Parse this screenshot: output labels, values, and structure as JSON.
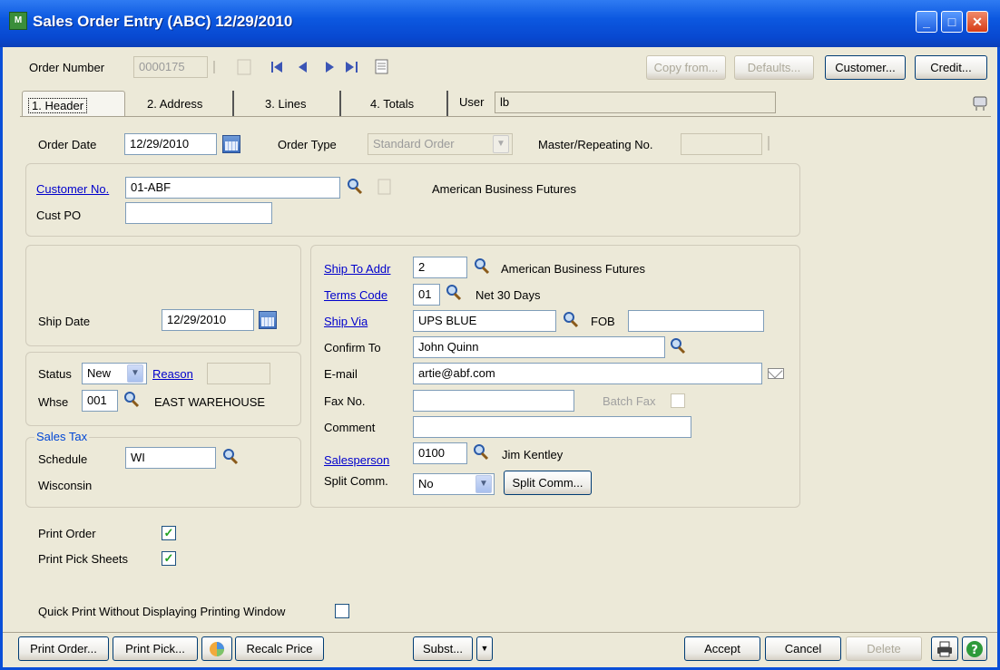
{
  "window": {
    "title": "Sales Order Entry (ABC) 12/29/2010"
  },
  "toolbar": {
    "order_number_label": "Order Number",
    "order_number_value": "0000175",
    "copy_from": "Copy from...",
    "defaults": "Defaults...",
    "customer": "Customer...",
    "credit": "Credit..."
  },
  "tabs": [
    "1. Header",
    "2. Address",
    "3. Lines",
    "4. Totals"
  ],
  "user": {
    "label": "User",
    "value": "lb"
  },
  "header": {
    "order_date_label": "Order Date",
    "order_date": "12/29/2010",
    "order_type_label": "Order Type",
    "order_type": "Standard Order",
    "master_label": "Master/Repeating No.",
    "master_value": "",
    "customer_no_label": "Customer No.",
    "customer_no": "01-ABF",
    "customer_name": "American Business Futures",
    "cust_po_label": "Cust PO",
    "cust_po": ""
  },
  "left": {
    "ship_date_label": "Ship Date",
    "ship_date": "12/29/2010",
    "status_label": "Status",
    "status": "New",
    "reason_label": "Reason",
    "reason": "",
    "whse_label": "Whse",
    "whse": "001",
    "whse_name": "EAST WAREHOUSE",
    "sales_tax_label": "Sales Tax",
    "schedule_label": "Schedule",
    "schedule": "WI",
    "schedule_name": "Wisconsin"
  },
  "right": {
    "ship_to_label": "Ship To Addr",
    "ship_to": "2",
    "ship_to_name": "American Business Futures",
    "terms_label": "Terms Code",
    "terms": "01",
    "terms_name": "Net 30 Days",
    "ship_via_label": "Ship Via",
    "ship_via": "UPS BLUE",
    "fob_label": "FOB",
    "fob": "",
    "confirm_label": "Confirm To",
    "confirm": "John Quinn",
    "email_label": "E-mail",
    "email": "artie@abf.com",
    "fax_label": "Fax No.",
    "fax": "",
    "batch_fax_label": "Batch Fax",
    "comment_label": "Comment",
    "comment": "",
    "salesperson_label": "Salesperson",
    "salesperson": "0100",
    "salesperson_name": "Jim Kentley",
    "split_label": "Split Comm.",
    "split": "No",
    "split_button": "Split Comm..."
  },
  "print": {
    "print_order_label": "Print Order",
    "print_pick_label": "Print Pick Sheets",
    "quick_print_label": "Quick Print Without Displaying Printing Window"
  },
  "bottom": {
    "print_order": "Print Order...",
    "print_pick": "Print Pick...",
    "recalc": "Recalc Price",
    "subst": "Subst...",
    "accept": "Accept",
    "cancel": "Cancel",
    "delete": "Delete"
  },
  "colors": {
    "title_bar": "#0c58e0",
    "link": "#0000cc",
    "check": "#21a121"
  }
}
